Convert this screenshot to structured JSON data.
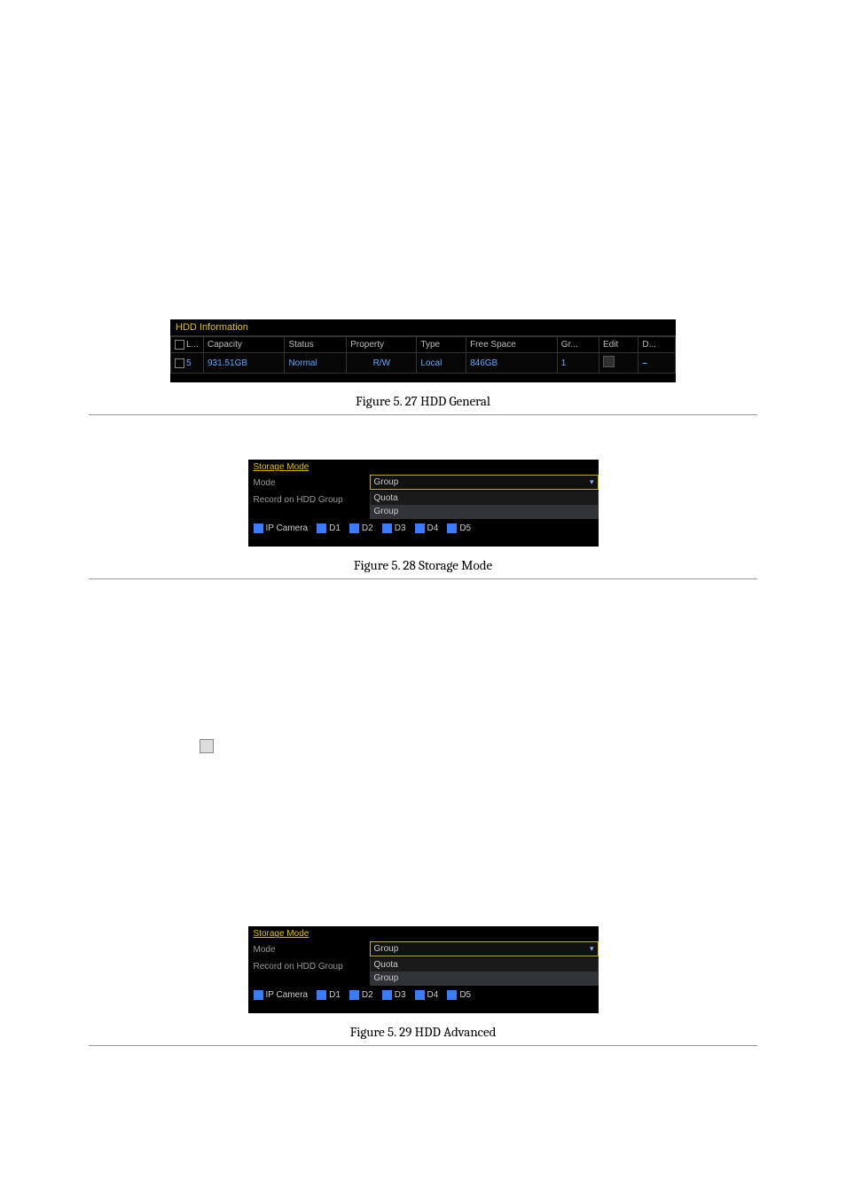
{
  "figure1": {
    "panel_title": "HDD Information",
    "columns": [
      "L...",
      "Capacity",
      "Status",
      "Property",
      "Type",
      "Free Space",
      "Gr...",
      "Edit",
      "D..."
    ],
    "row": {
      "num": "5",
      "capacity": "931.51GB",
      "status": "Normal",
      "property": "R/W",
      "type": "Local",
      "free_space": "846GB",
      "group": "1"
    },
    "caption": "Figure 5. 27  HDD General"
  },
  "figure2": {
    "panel_title": "Storage Mode",
    "mode_label": "Mode",
    "mode_value": "Group",
    "record_label": "Record on HDD Group",
    "dropdown_options": [
      "Quota",
      "Group"
    ],
    "camera_label": "IP Camera",
    "cameras": [
      "D1",
      "D2",
      "D3",
      "D4",
      "D5"
    ],
    "caption": "Figure 5. 28  Storage Mode"
  },
  "figure3": {
    "panel_title": "Storage Mode",
    "mode_label": "Mode",
    "mode_value": "Group",
    "record_label": "Record on HDD Group",
    "dropdown_options": [
      "Quota",
      "Group"
    ],
    "camera_label": "IP Camera",
    "cameras": [
      "D1",
      "D2",
      "D3",
      "D4",
      "D5"
    ],
    "caption": "Figure 5. 29  HDD Advanced"
  }
}
